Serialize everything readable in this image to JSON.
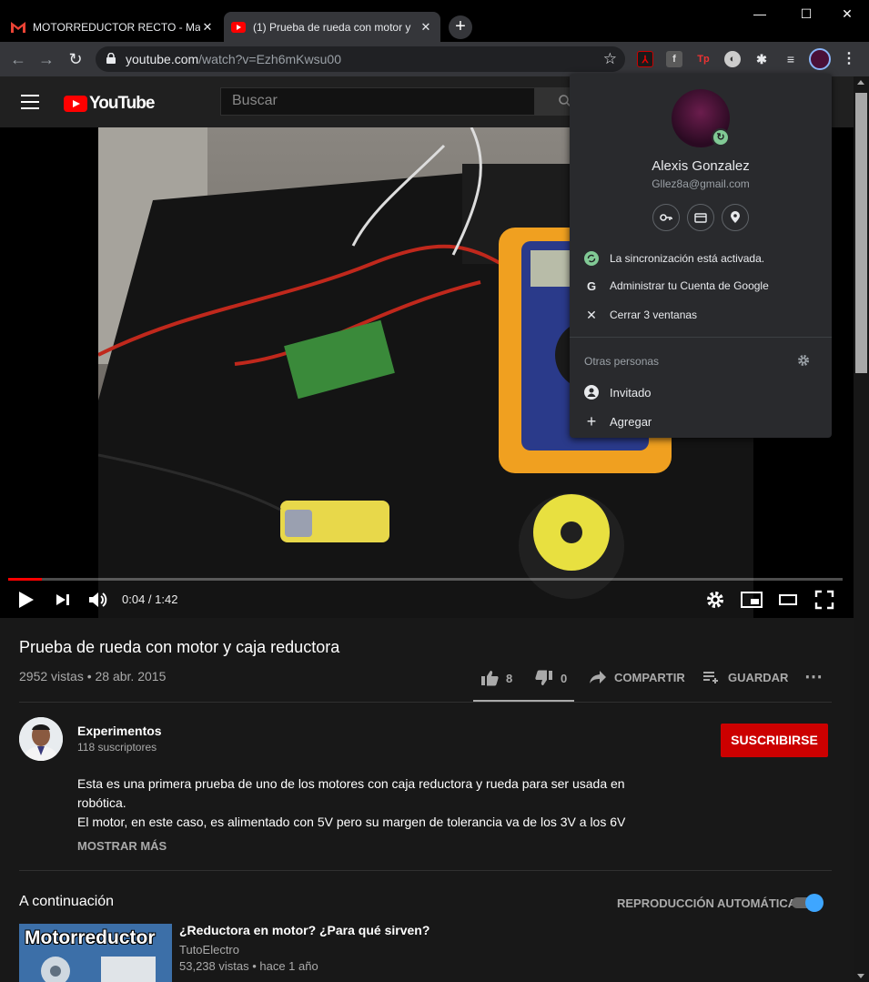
{
  "browser": {
    "tabs": [
      {
        "title": "MOTORREDUCTOR RECTO - Mast",
        "icon": "gmail-icon"
      },
      {
        "title": "(1) Prueba de rueda con motor y",
        "icon": "youtube-icon"
      }
    ],
    "url_host": "youtube.com",
    "url_path": "/watch?v=Ezh6mKwsu00",
    "window_buttons": {
      "minimize": "—",
      "maximize": "☐",
      "close": "✕"
    }
  },
  "profile_menu": {
    "name": "Alexis Gonzalez",
    "email": "Gllez8a@gmail.com",
    "sync_status": "La sincronización está activada.",
    "manage_account": "Administrar tu Cuenta de Google",
    "close_windows": "Cerrar 3 ventanas",
    "other_people_title": "Otras personas",
    "guest": "Invitado",
    "add": "Agregar"
  },
  "youtube": {
    "logo_text": "YouTube",
    "search_placeholder": "Buscar",
    "player": {
      "time": "0:04 / 1:42",
      "progress": 0.04
    },
    "video": {
      "title": "Prueba de rueda con motor y caja reductora",
      "meta": "2952 vistas • 28 abr. 2015",
      "likes": "8",
      "dislikes": "0",
      "share_label": "COMPARTIR",
      "save_label": "GUARDAR"
    },
    "channel": {
      "name": "Experimentos",
      "subscribers": "118 suscriptores",
      "subscribe_label": "SUSCRIBIRSE"
    },
    "description": {
      "line1": "Esta es una primera prueba de uno de los motores con caja reductora y rueda para ser usada en",
      "line2": "robótica.",
      "line3": "El motor, en este caso, es alimentado con 5V pero su margen de tolerancia va de los 3V a los 6V",
      "more_label": "MOSTRAR MÁS"
    },
    "up_next": {
      "heading": "A continuación",
      "autoplay_label": "REPRODUCCIÓN AUTOMÁTICA",
      "autoplay_on": true,
      "item": {
        "thumb_text": "Motorreductor",
        "title": "¿Reductora en motor? ¿Para qué sirven?",
        "channel": "TutoElectro",
        "meta": "53,238 vistas • hace 1 año"
      }
    }
  },
  "colors": {
    "subscribe": "#cc0000",
    "progress": "#ff0000",
    "sync": "#81c995",
    "toggle": "#3ea6ff"
  }
}
